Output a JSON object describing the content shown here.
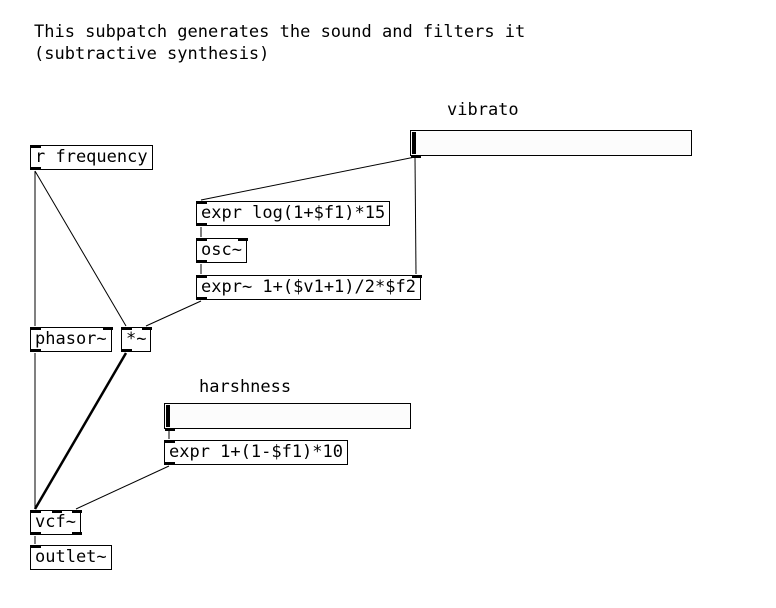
{
  "header": {
    "line1": "This subpatch generates the sound and filters it",
    "line2": "(subtractive synthesis)"
  },
  "labels": {
    "vibrato": "vibrato",
    "harshness": "harshness"
  },
  "objects": {
    "r_frequency": "r frequency",
    "phasor": "phasor~",
    "mult": "*~",
    "expr_vib": "expr log(1+$f1)*15",
    "osc": "osc~",
    "expr_mod": "expr~ 1+($v1+1)/2*$f2",
    "expr_harsh": "expr 1+(1-$f1)*10",
    "vcf": "vcf~",
    "outlet": "outlet~"
  },
  "sliders": {
    "vibrato_value": 0,
    "harshness_value": 0
  },
  "connections": [
    {
      "from": "vibrato_slider.out0",
      "to": "expr_vib.in0"
    },
    {
      "from": "vibrato_slider.out0",
      "to": "expr_mod.in1"
    },
    {
      "from": "expr_vib.out0",
      "to": "osc.in0"
    },
    {
      "from": "osc.out0",
      "to": "expr_mod.in0"
    },
    {
      "from": "r_frequency.out0",
      "to": "phasor.in0"
    },
    {
      "from": "r_frequency.out0",
      "to": "mult.in0"
    },
    {
      "from": "phasor.out0",
      "to": "vcf.in0"
    },
    {
      "from": "expr_mod.out0",
      "to": "mult.in1"
    },
    {
      "from": "mult.out0",
      "to": "vcf.in0",
      "signal": true
    },
    {
      "from": "harshness_slider.out0",
      "to": "expr_harsh.in0"
    },
    {
      "from": "expr_harsh.out0",
      "to": "vcf.in2"
    },
    {
      "from": "vcf.out0",
      "to": "outlet.in0"
    }
  ]
}
